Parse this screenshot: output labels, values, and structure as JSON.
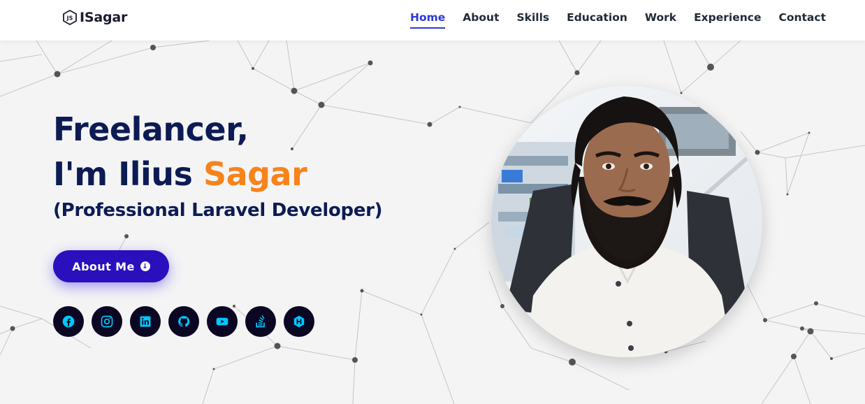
{
  "brand": {
    "name": "ISagar",
    "logo_icon": "hexagon-js-logo-icon"
  },
  "nav": {
    "items": [
      {
        "label": "Home",
        "active": true
      },
      {
        "label": "About",
        "active": false
      },
      {
        "label": "Skills",
        "active": false
      },
      {
        "label": "Education",
        "active": false
      },
      {
        "label": "Work",
        "active": false
      },
      {
        "label": "Experience",
        "active": false
      },
      {
        "label": "Contact",
        "active": false
      }
    ],
    "active_color": "#2b3ad8"
  },
  "hero": {
    "line1": "Freelancer,",
    "line2_prefix": "I'm Ilius ",
    "line2_accent": "Sagar",
    "subtitle": "(Professional Laravel Developer)",
    "accent_color": "#f7831b",
    "title_color": "#0d1b54"
  },
  "about_button": {
    "label": "About Me",
    "icon": "arrow-circle-down-icon",
    "color": "#2a0fbd"
  },
  "socials": [
    {
      "name": "facebook",
      "icon": "facebook-icon"
    },
    {
      "name": "instagram",
      "icon": "instagram-icon"
    },
    {
      "name": "linkedin",
      "icon": "linkedin-icon"
    },
    {
      "name": "github",
      "icon": "github-icon"
    },
    {
      "name": "youtube",
      "icon": "youtube-icon"
    },
    {
      "name": "stackoverflow",
      "icon": "stackoverflow-icon"
    },
    {
      "name": "hashnode",
      "icon": "hashnode-icon"
    }
  ],
  "social_icon_color": "#00c8ff",
  "portrait": {
    "description_icon": "profile-photo"
  }
}
